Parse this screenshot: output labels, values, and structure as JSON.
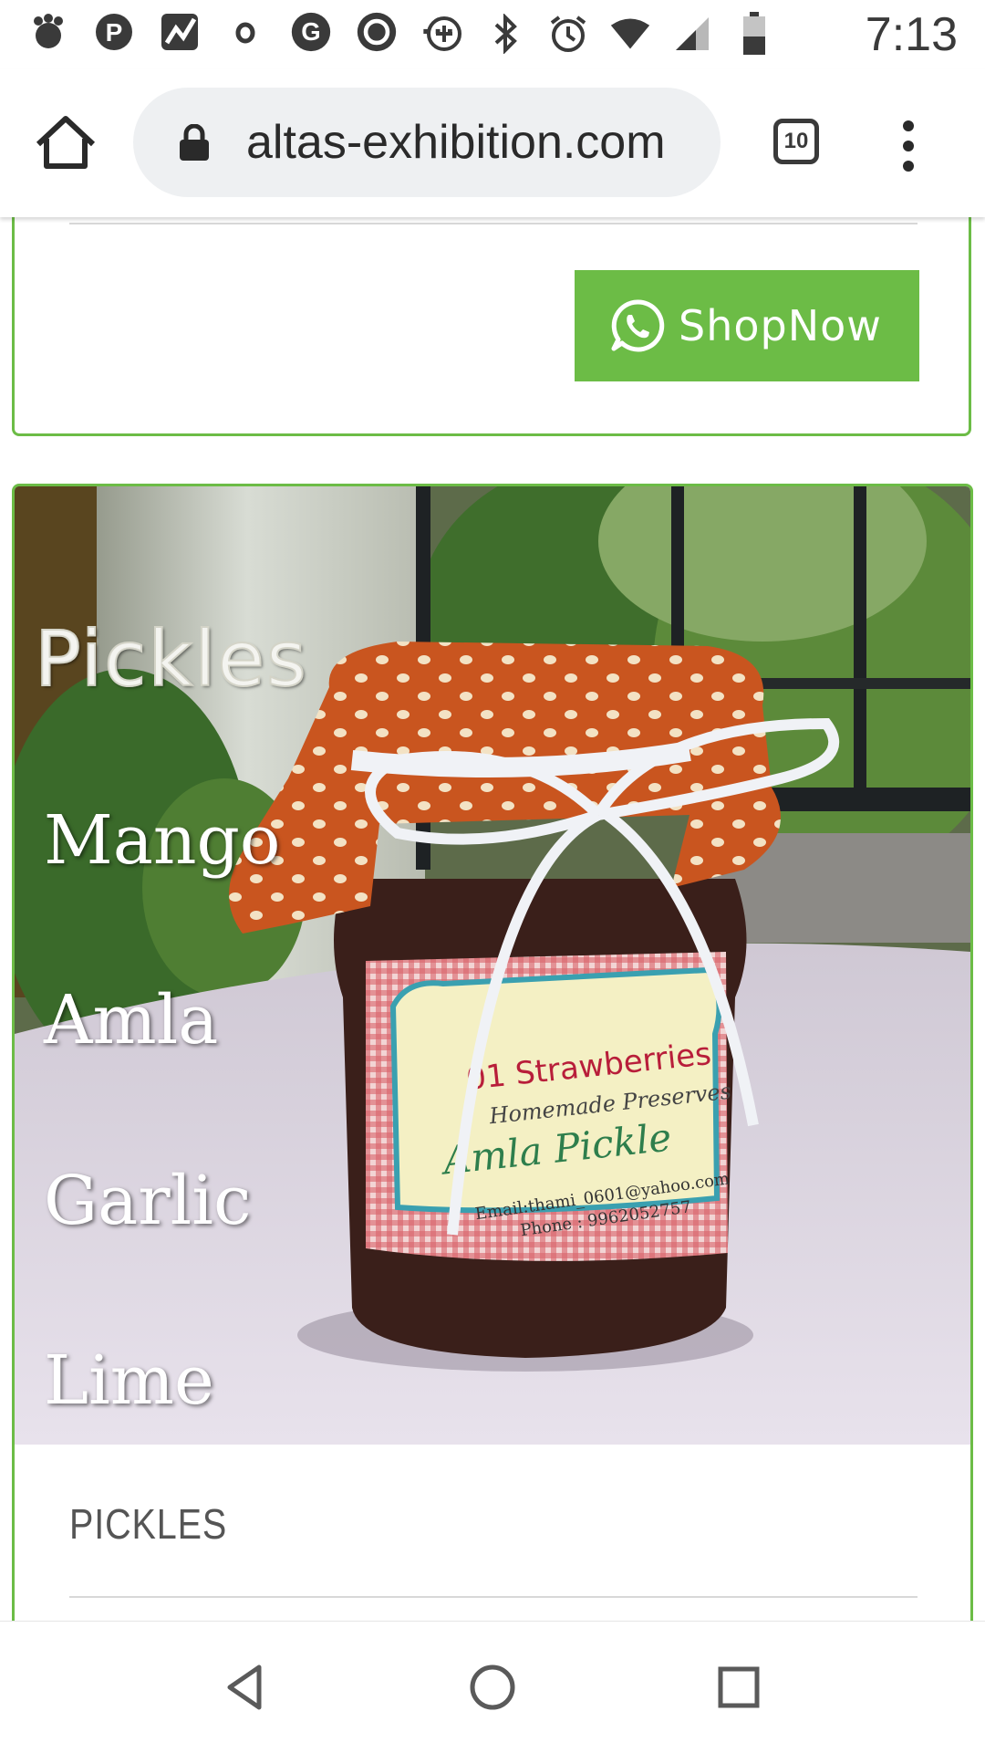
{
  "status_bar": {
    "time": "7:13",
    "left_icons": [
      "cluster-icon",
      "pinterest-icon",
      "trend-icon",
      "small-circle-icon",
      "google-icon",
      "camera-ring-icon"
    ],
    "overflow": "···",
    "right_icons": [
      "data-saver-icon",
      "bluetooth-icon",
      "alarm-icon",
      "wifi-icon",
      "signal-icon",
      "battery-icon"
    ]
  },
  "browser": {
    "url": "altas-exhibition.com",
    "tab_count": "10",
    "home_icon": "home-icon",
    "lock_icon": "lock-icon",
    "menu_icon": "more-vert-icon"
  },
  "shop_card": {
    "button_label": "ShopNow",
    "button_icon": "whatsapp-icon",
    "button_color": "#6cbc46"
  },
  "product_card": {
    "image": {
      "overlay_title": "Pickles",
      "overlay_items": [
        "Mango",
        "Amla",
        "Garlic",
        "Lime"
      ],
      "label_lines": [
        "01 Strawberries",
        "Homemade Preserves",
        "Amla Pickle",
        "Email:thami_0601@yahoo.com",
        "Phone : 9962052757"
      ]
    },
    "caption": "PICKLES"
  },
  "nav_bar": {
    "buttons": [
      "back-icon",
      "home-circle-icon",
      "recents-icon"
    ]
  },
  "colors": {
    "accent_green": "#6cbc46",
    "text_dark": "#3a3a3a",
    "caption_gray": "#555555"
  }
}
